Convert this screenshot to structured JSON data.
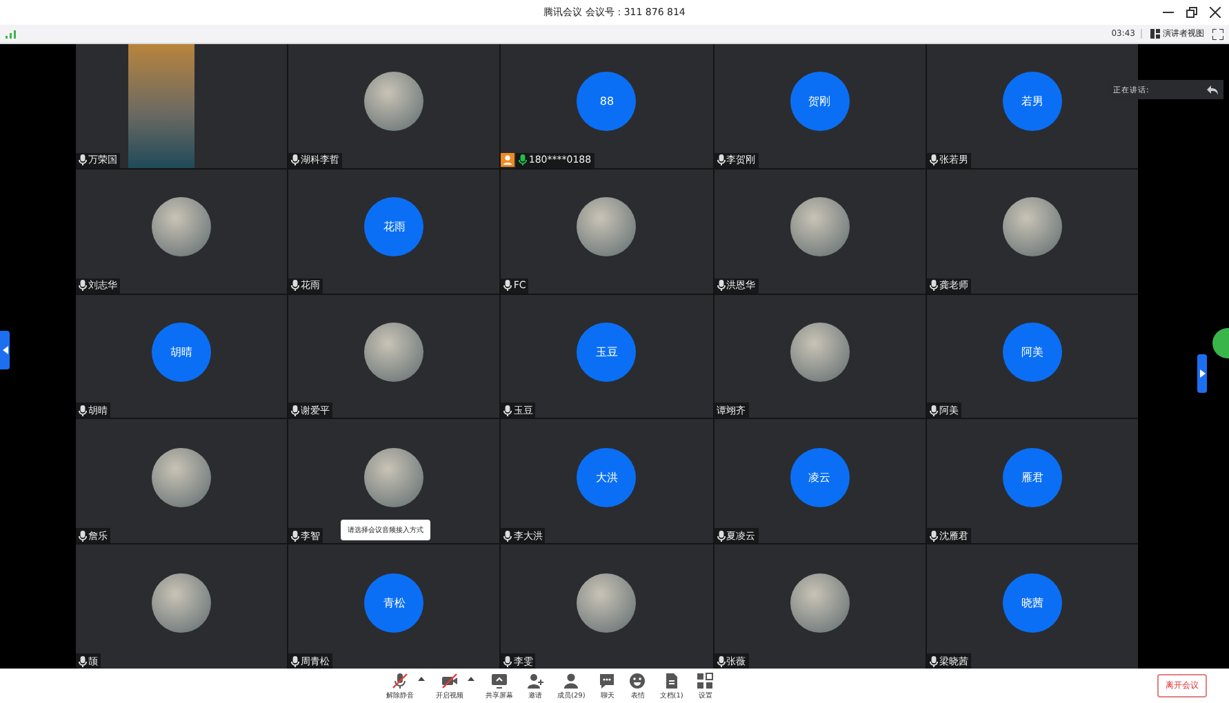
{
  "window": {
    "title": "腾讯会议  会议号：311 876 814"
  },
  "status_bar": {
    "timer": "03:43",
    "view_button": "演讲者视图"
  },
  "speaking_panel": {
    "label": "正在讲话:"
  },
  "tiles": [
    {
      "name": "万荣国",
      "kind": "video",
      "mic": true,
      "speaking": false
    },
    {
      "name": "湖科李哲",
      "kind": "photo",
      "mic": true,
      "speaking": false
    },
    {
      "name": "180****0188",
      "kind": "initials",
      "initials": "88",
      "mic": true,
      "speaking": true,
      "dial_in": true
    },
    {
      "name": "李贺刚",
      "kind": "initials",
      "initials": "贺刚",
      "mic": true,
      "speaking": false
    },
    {
      "name": "张若男",
      "kind": "initials",
      "initials": "若男",
      "mic": true,
      "speaking": false
    },
    {
      "name": "刘志华",
      "kind": "photo",
      "mic": true,
      "speaking": false
    },
    {
      "name": "花雨",
      "kind": "initials",
      "initials": "花雨",
      "mic": true,
      "speaking": false
    },
    {
      "name": "FC",
      "kind": "photo",
      "mic": true,
      "speaking": false
    },
    {
      "name": "洪恩华",
      "kind": "photo",
      "mic": true,
      "speaking": false
    },
    {
      "name": "龚老师",
      "kind": "photo",
      "mic": true,
      "speaking": false
    },
    {
      "name": "胡晴",
      "kind": "initials",
      "initials": "胡晴",
      "mic": true,
      "speaking": false
    },
    {
      "name": "谢爱平",
      "kind": "photo",
      "mic": true,
      "speaking": false
    },
    {
      "name": "玉豆",
      "kind": "initials",
      "initials": "玉豆",
      "mic": true,
      "speaking": false
    },
    {
      "name": "谭翊齐",
      "kind": "photo",
      "mic": false
    },
    {
      "name": "阿美",
      "kind": "initials",
      "initials": "阿美",
      "mic": true,
      "speaking": false
    },
    {
      "name": "詹乐",
      "kind": "photo",
      "mic": true,
      "speaking": false
    },
    {
      "name": "李智",
      "kind": "photo",
      "mic": true,
      "speaking": false,
      "tooltip": "请选择会议音频接入方式"
    },
    {
      "name": "李大洪",
      "kind": "initials",
      "initials": "大洪",
      "mic": true,
      "speaking": false
    },
    {
      "name": "夏凌云",
      "kind": "initials",
      "initials": "凌云",
      "mic": true,
      "speaking": false
    },
    {
      "name": "沈雁君",
      "kind": "initials",
      "initials": "雁君",
      "mic": true,
      "speaking": false
    },
    {
      "name": "颉",
      "kind": "photo",
      "mic": true,
      "speaking": false
    },
    {
      "name": "周青松",
      "kind": "initials",
      "initials": "青松",
      "mic": true,
      "speaking": false
    },
    {
      "name": "李雯",
      "kind": "photo",
      "mic": true,
      "speaking": false
    },
    {
      "name": "张薇",
      "kind": "photo",
      "mic": true,
      "speaking": false
    },
    {
      "name": "梁晓茜",
      "kind": "initials",
      "initials": "晓茜",
      "mic": true,
      "speaking": false
    }
  ],
  "toolbar": [
    {
      "label": "解除静音",
      "kind": "mic",
      "caret": true
    },
    {
      "label": "开启视频",
      "kind": "camera",
      "caret": true
    },
    {
      "label": "共享屏幕",
      "kind": "screen",
      "caret": false
    },
    {
      "label": "邀请",
      "kind": "invite",
      "caret": false
    },
    {
      "label": "成员(29)",
      "kind": "members",
      "caret": false
    },
    {
      "label": "聊天",
      "kind": "chat",
      "caret": false
    },
    {
      "label": "表情",
      "kind": "smile",
      "caret": false
    },
    {
      "label": "文档(1)",
      "kind": "document",
      "caret": false
    },
    {
      "label": "设置",
      "kind": "settings",
      "caret": false
    }
  ],
  "leave_button": "离开会议"
}
